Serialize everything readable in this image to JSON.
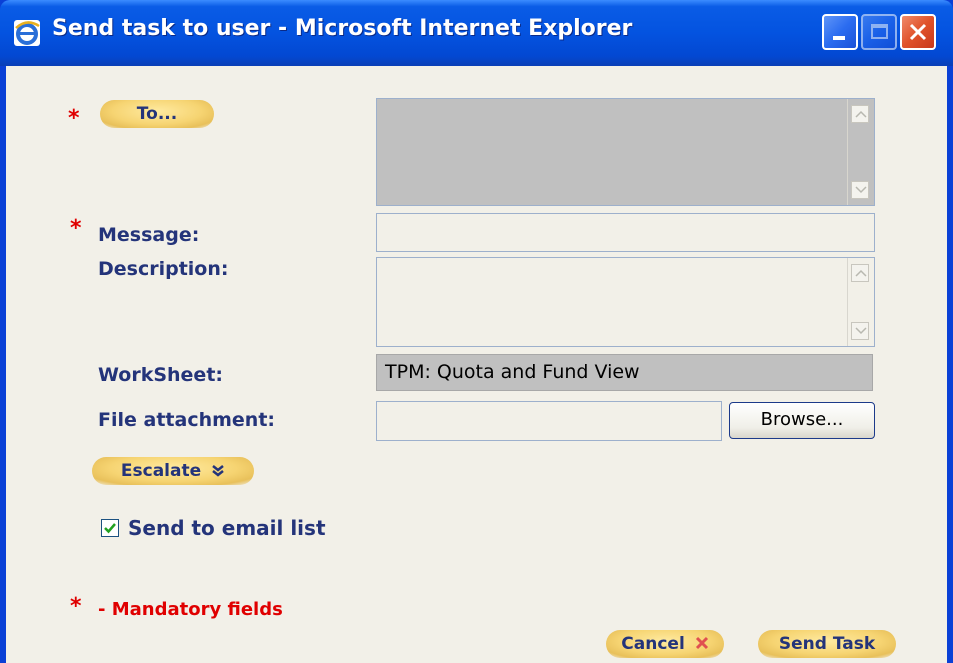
{
  "window": {
    "title": "Send task to user - Microsoft Internet Explorer"
  },
  "form": {
    "to_button": "To...",
    "to_required_mark": "*",
    "message_label": "Message:",
    "message_required_mark": "*",
    "message_value": "",
    "description_label": "Description:",
    "description_value": "",
    "worksheet_label": "WorkSheet:",
    "worksheet_value": "TPM: Quota and Fund View",
    "file_attachment_label": "File attachment:",
    "file_attachment_value": "",
    "browse_button": "Browse...",
    "escalate_button": "Escalate",
    "escalate_icon": "double-chevron-down-icon",
    "send_email_label": "Send to email list",
    "send_email_checked": true,
    "mandatory_mark": "*",
    "mandatory_note": "- Mandatory fields"
  },
  "footer": {
    "cancel_button": "Cancel",
    "cancel_icon": "x-icon",
    "send_button": "Send Task"
  },
  "colors": {
    "label": "#24347a",
    "required": "#e00000",
    "pill": "#f6d472",
    "titlebar": "#0453e0"
  }
}
